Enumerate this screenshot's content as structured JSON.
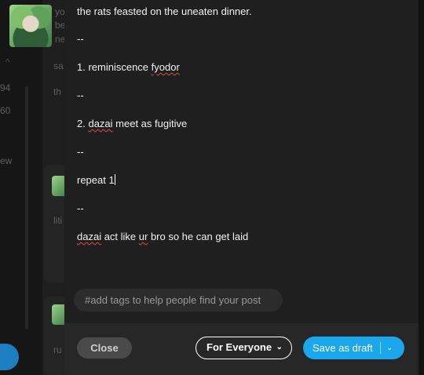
{
  "background": {
    "left_numbers": [
      "94",
      "60"
    ],
    "left_label": "ew",
    "panel_snippets": [
      "yo",
      "be",
      "ne",
      "sa",
      "th",
      "liti",
      "ru"
    ]
  },
  "editor": {
    "lines": [
      [
        {
          "t": "the rats feasted on the uneaten dinner."
        }
      ],
      [
        {
          "t": "--"
        }
      ],
      [
        {
          "t": " 1. reminiscence "
        },
        {
          "t": "fyodor",
          "sp": true
        }
      ],
      [
        {
          "t": "--"
        }
      ],
      [
        {
          "t": "2. "
        },
        {
          "t": "dazai",
          "sp": true
        },
        {
          "t": " meet as fugitive"
        }
      ],
      [
        {
          "t": "--"
        }
      ],
      [
        {
          "t": "repeat 1"
        }
      ],
      [
        {
          "t": "--"
        }
      ],
      [
        {
          "t": "dazai",
          "sp": true
        },
        {
          "t": " act like "
        },
        {
          "t": "ur",
          "sp": true
        },
        {
          "t": " bro so he can get laid"
        }
      ]
    ]
  },
  "tags": {
    "placeholder": "#add tags to help people find your post"
  },
  "footer": {
    "close_label": "Close",
    "audience_label": "For Everyone",
    "save_label": "Save as draft"
  },
  "colors": {
    "accent": "#1aa7ec",
    "modal_bg": "#1f1f1f",
    "spellcheck": "#e04b4b"
  }
}
